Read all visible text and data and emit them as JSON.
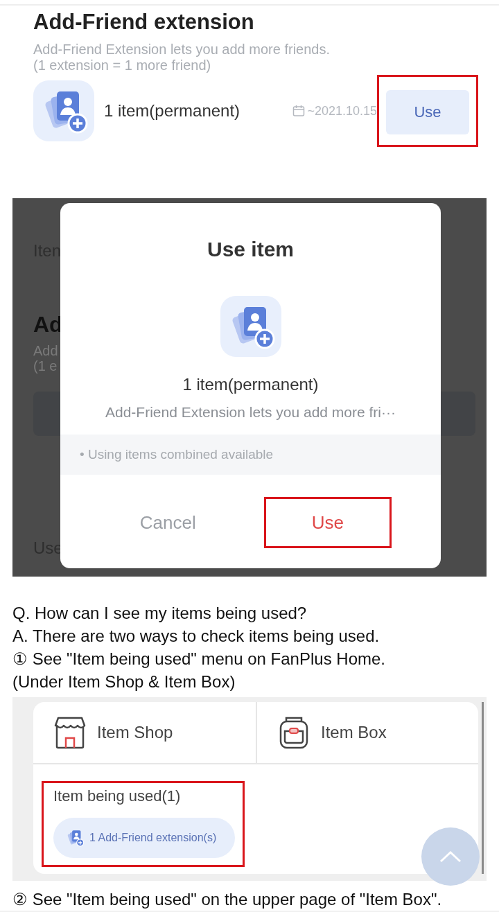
{
  "item_detail": {
    "title": "Add-Friend extension",
    "description": [
      "Add-Friend Extension lets you add more friends.",
      "(1 extension = 1 more friend)"
    ],
    "quantity": "1 item(permanent)",
    "expiry": "~2021.10.15",
    "button": {
      "label": "Use",
      "highlighted": true
    }
  },
  "use_dialog_screen": {
    "background_fragments": [
      {
        "text": "Iten",
        "kind": "label"
      },
      {
        "text": "Ad",
        "kind": "heading"
      },
      {
        "text": "Add",
        "kind": "description"
      },
      {
        "text": "(1 e",
        "kind": "description"
      },
      {
        "kind": "card"
      },
      {
        "text": "Use",
        "kind": "label"
      }
    ],
    "dialog": {
      "title": "Use item",
      "quantity": "1 item(permanent)",
      "description": "Add-Friend Extension lets you add more fri···",
      "note": "• Using items combined available",
      "buttons": [
        {
          "label": "Cancel",
          "kind": "cancel",
          "highlighted": false
        },
        {
          "label": "Use",
          "kind": "confirm",
          "highlighted": true
        }
      ]
    }
  },
  "paragraphs": [
    "Q. How can I see my items being used?",
    "A. There are two ways to check items being used.",
    "① See \"Item being used\" menu on FanPlus Home.",
    "(Under Item Shop & Item Box)"
  ],
  "home_screen": {
    "menu": [
      {
        "label": "Item Shop",
        "kind": "shop"
      },
      {
        "label": "Item Box",
        "kind": "box"
      }
    ],
    "in_use": {
      "title": "Item being used(1)",
      "chip": "1 Add-Friend extension(s)",
      "highlighted": true
    }
  },
  "paragraphs_after": [
    "② See \"Item being used\" on the upper page of \"Item Box\"."
  ]
}
